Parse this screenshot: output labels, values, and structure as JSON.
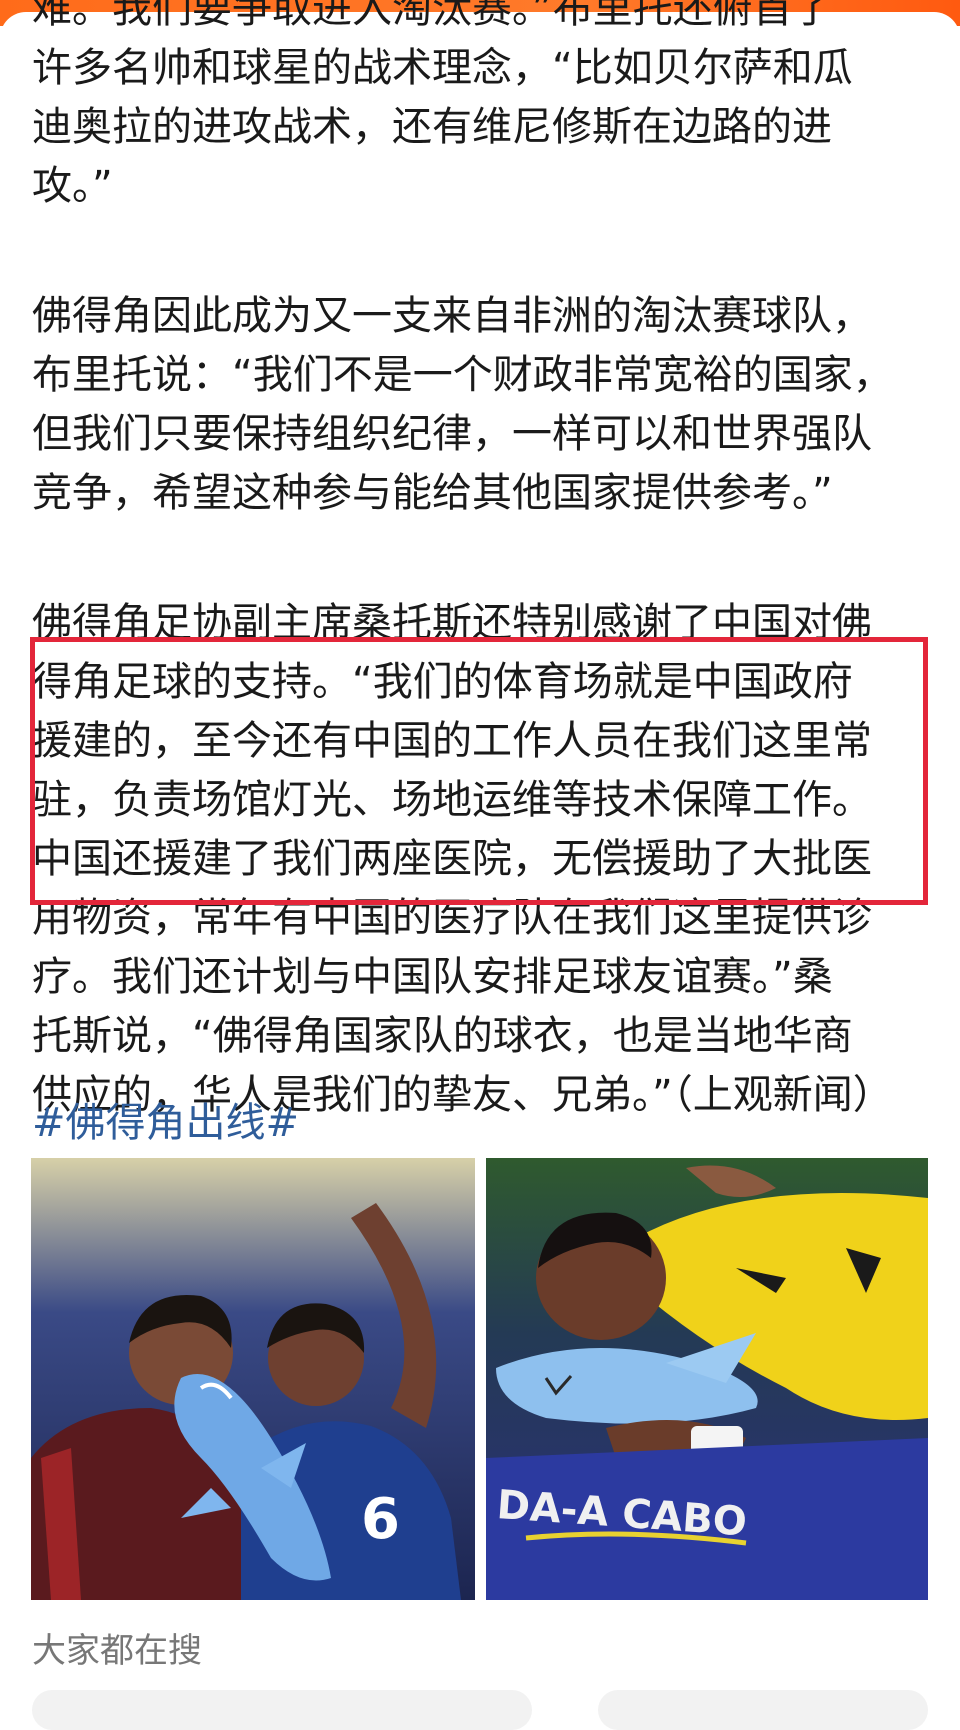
{
  "article": {
    "lines": [
      "难。我们要争取进入淘汰赛。”布里托还俯首了",
      "许多名帅和球星的战术理念，“比如贝尔萨和瓜",
      "迪奥拉的进攻战术，还有维尼修斯在边路的进",
      "攻。”",
      "",
      "佛得角因此成为又一支来自非洲的淘汰赛球队，",
      "布里托说：“我们不是一个财政非常宽裕的国家，",
      "但我们只要保持组织纪律，一样可以和世界强队",
      "竞争，希望这种参与能给其他国家提供参考。”",
      "",
      "佛得角足协副主席桑托斯还特别感谢了中国对佛",
      "得角足球的支持。“我们的体育场就是中国政府",
      "援建的，至今还有中国的工作人员在我们这里常",
      "驻，负责场馆灯光、场地运维等技术保障工作。",
      "中国还援建了我们两座医院，无偿援助了大批医",
      "用物资，常年有中国的医疗队在我们这里提供诊",
      "疗。我们还计划与中国队安排足球友谊赛。”桑",
      "托斯说，“佛得角国家队的球衣，也是当地华商",
      "供应的，华人是我们的挚友、兄弟。”（上观新闻）"
    ],
    "hashtag": "#佛得角出线#"
  },
  "images": {
    "left_alt": "",
    "right_alt": ""
  },
  "section": {
    "trending_label": "大家都在搜"
  },
  "colors": {
    "accent": "#ff6b1a",
    "highlight": "#e3263a",
    "hashtag": "#2f5d9a",
    "muted": "#777777"
  }
}
